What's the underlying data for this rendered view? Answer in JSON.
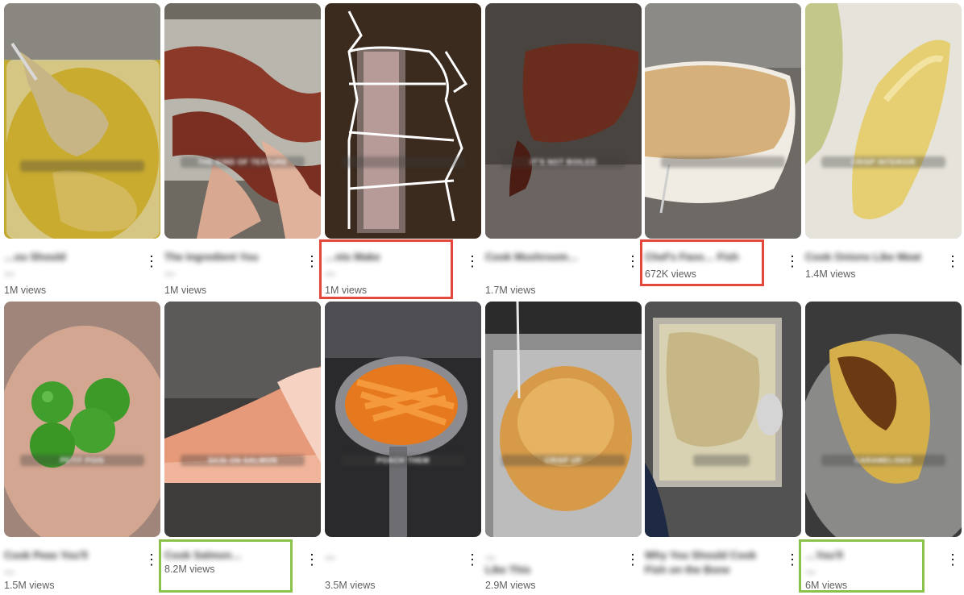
{
  "grid": {
    "row1": [
      {
        "caption": "",
        "title1": "…ou Should",
        "title2": "…",
        "views": "1M views"
      },
      {
        "caption": "THE KIND OF TEXTURE",
        "title1": "The Ingredient You",
        "title2": "…",
        "views": "1M views"
      },
      {
        "caption": "",
        "title1": "…nts Make",
        "title2": "…",
        "views": "1M views"
      },
      {
        "caption": "IT'S NOT BOILED",
        "title1": "Cook Mushroom…",
        "title2": "",
        "views": "1.7M views"
      },
      {
        "caption": "",
        "title1": "Chef's Favo… Fish",
        "title2": "",
        "views": "672K views"
      },
      {
        "caption": "CRISP INTERIOR",
        "title1": "Cook Onions Like Meat",
        "title2": "",
        "views": "1.4M views"
      }
    ],
    "row2": [
      {
        "caption": "PETIT POIS",
        "title1": "Cook Peas You'll",
        "title2": "…",
        "views": "1.5M views"
      },
      {
        "caption": "SKIN ON SALMON",
        "title1": "Cook Salmon…",
        "title2": "",
        "views": "8.2M views"
      },
      {
        "caption": "POACH THEM",
        "title1": "…",
        "title2": "",
        "views": "3.5M views"
      },
      {
        "caption": "CRISP UP",
        "title1": "…",
        "title2": "Like This",
        "views": "2.9M views"
      },
      {
        "caption": "",
        "title1": "Why You Should Cook",
        "title2": "Fish on the Bone",
        "views": ""
      },
      {
        "caption": "CARAMELISED",
        "title1": "…You'll",
        "title2": "…",
        "views": "6M views"
      }
    ]
  },
  "more_icon": "vertical-ellipsis-icon",
  "more_glyph": "⋮",
  "colors": {
    "red_highlight": "#e4473c",
    "green_highlight": "#8bc34a",
    "views_text": "#606060"
  }
}
